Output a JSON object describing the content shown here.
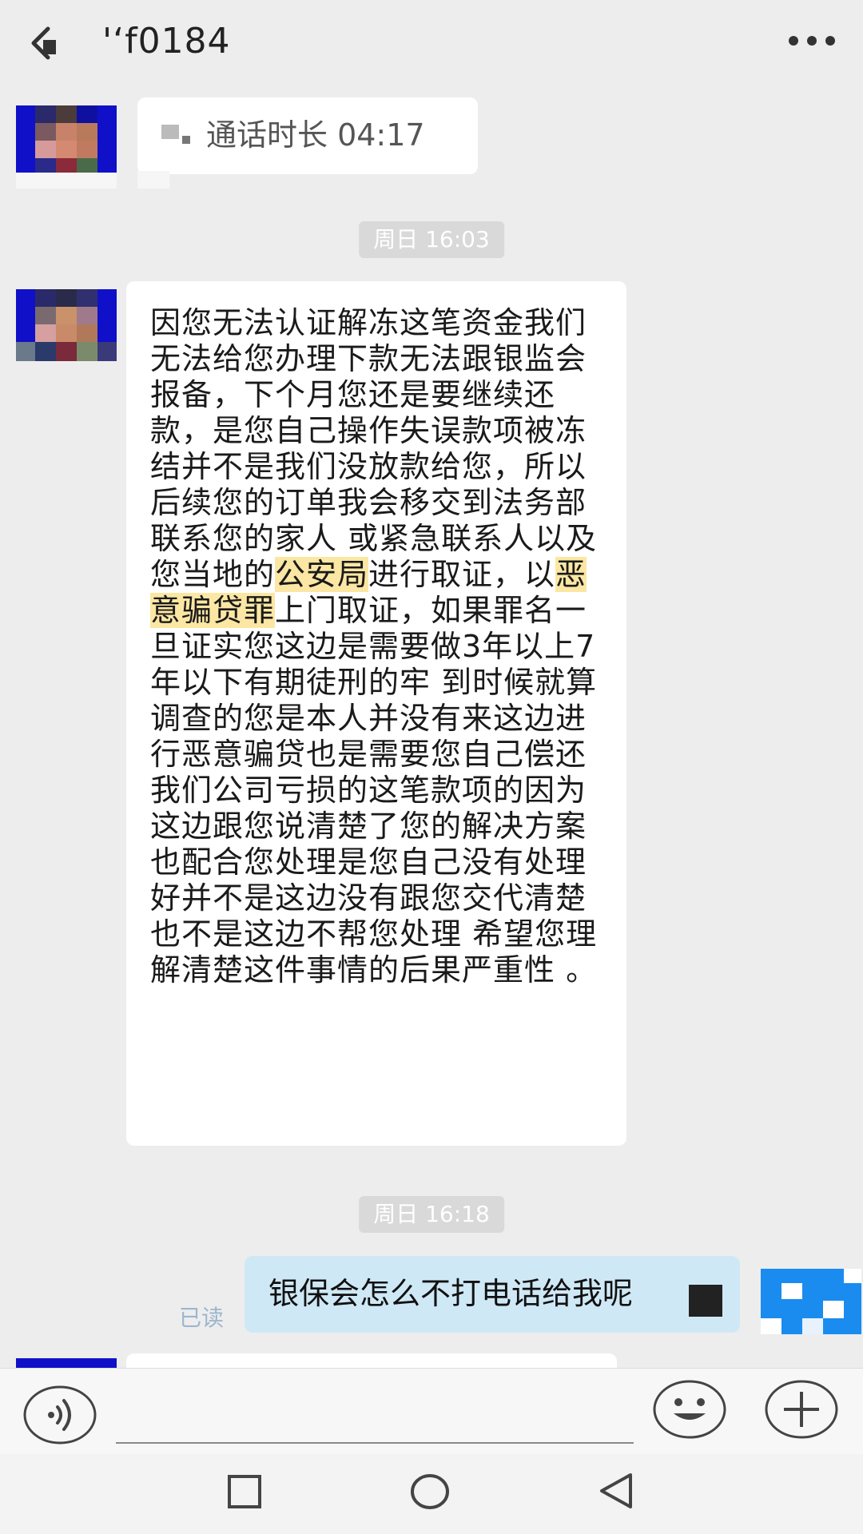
{
  "header": {
    "title": "'‘f0184",
    "back_icon": "back-arrow-icon",
    "more_icon": "more-dots-icon"
  },
  "messages": {
    "call_record": {
      "icon": "phone-call-icon",
      "text": "通话时长 04:17"
    },
    "time_1": "周日 16:03",
    "long_message": {
      "text_before_1": "因您无法认证解冻这笔资金我们无法给您办理下款无法跟银监会报备，下个月您还是要继续还款，是您自己操作失误款项被冻结并不是我们没放款给您，所以后续您的订单我会移交到法务部联系您的家人 或紧急联系人以及您当地的",
      "highlight_1": "公安局",
      "text_between": "进行取证，以",
      "highlight_2": "恶意骗贷罪",
      "text_after_2": "上门取证，如果罪名一旦证实您这边是需要做3年以上7年以下有期徒刑的牢 到时候就算调查的您是本人并没有来这边进行恶意骗贷也是需要您自己偿还我们公司亏损的这笔款项的因为这边跟您说清楚了您的解决方案也配合您处理是您自己没有处理好并不是这边没有跟您交代清楚 也不是这边不帮您处理 希望您理解清楚这件事情的后果严重性 。",
      "highlight_color": "#fbe7a3"
    },
    "time_2": "周日 16:18",
    "outgoing": {
      "text": "银保会怎么不打电话给我呢",
      "read_status": "已读",
      "bubble_color": "#cfe8f6"
    }
  },
  "input_bar": {
    "voice_icon": "voice-icon",
    "emoji_icon": "emoji-icon",
    "plus_icon": "plus-icon"
  },
  "nav_bar": {
    "recent_icon": "recent-apps-icon",
    "home_icon": "home-icon",
    "back_icon": "nav-back-icon"
  }
}
